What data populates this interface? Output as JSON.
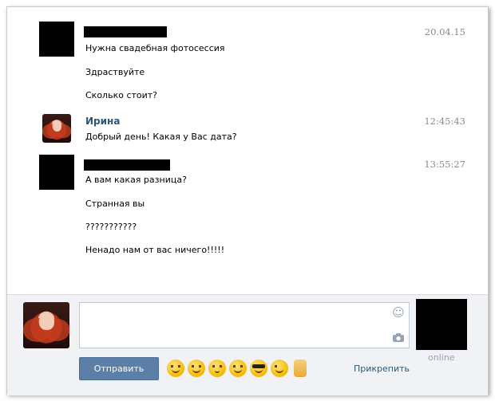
{
  "messages": [
    {
      "lines": [
        "Нужна свадебная фотосессия",
        "Здраствуйте",
        "Сколько стоит?"
      ],
      "time": "20.04.15"
    },
    {
      "name": "Ирина",
      "lines": [
        "Добрый день! Какая у Вас дата?"
      ],
      "time": "12:45:43"
    },
    {
      "lines": [
        "А вам какая разница?",
        "Странная вы",
        "???????????",
        "Ненадо нам от вас ничего!!!!!"
      ],
      "time": "13:55:27"
    }
  ],
  "composer": {
    "input_value": "",
    "send_label": "Отправить",
    "attach_label": "Прикрепить",
    "online_label": "online",
    "emojis": [
      "grin-emoji",
      "laugh-emoji",
      "kiss-emoji",
      "blush-emoji",
      "sunglasses-emoji",
      "wink-emoji",
      "thumbs-up-emoji"
    ]
  },
  "icons": {
    "smile": "smile-icon",
    "camera": "camera-icon"
  },
  "colors": {
    "link": "#2b587a",
    "send_button": "#5b7fa6",
    "time": "#8a8a8a"
  }
}
